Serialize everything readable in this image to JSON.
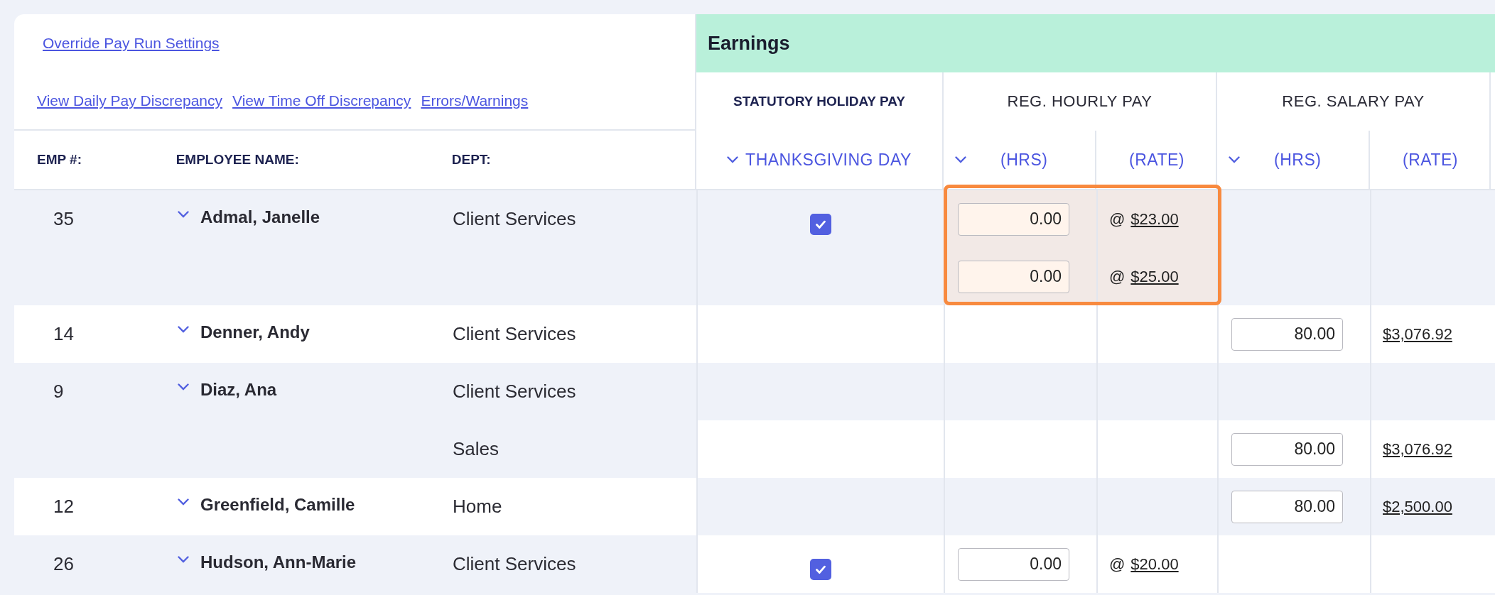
{
  "top_links": [
    {
      "label": "Override Pay Run Settings"
    }
  ],
  "discrepancy_links": [
    {
      "label": "View Daily Pay Discrepancy"
    },
    {
      "label": "View Time Off Discrepancy"
    },
    {
      "label": "Errors/Warnings"
    }
  ],
  "columns": {
    "emp_no": "EMP #:",
    "name": "EMPLOYEE NAME:",
    "dept": "DEPT:"
  },
  "section_title": "Earnings",
  "earning_groups": [
    {
      "title": "STATUTORY HOLIDAY PAY",
      "kind": "holiday",
      "subcolumns": [
        {
          "label": "THANKSGIVING DAY",
          "dropdown": true
        }
      ]
    },
    {
      "title": "REG. HOURLY PAY",
      "kind": "hours_rate",
      "subcolumns": [
        {
          "label": "(HRS)",
          "dropdown": true
        },
        {
          "label": "(RATE)",
          "dropdown": false
        }
      ]
    },
    {
      "title": "REG. SALARY PAY",
      "kind": "hours_rate",
      "subcolumns": [
        {
          "label": "(HRS)",
          "dropdown": true
        },
        {
          "label": "(RATE)",
          "dropdown": false
        }
      ]
    }
  ],
  "employees": [
    {
      "emp_no": "35",
      "name": "Admal, Janelle",
      "shaded": true,
      "hourly_highlighted": true,
      "lines": [
        {
          "dept": "Client Services",
          "shaded": true,
          "holiday_checked": true,
          "hourly": {
            "hours": "0.00",
            "prefix": "@",
            "rate": "$23.00"
          }
        },
        {
          "shaded": true,
          "hourly": {
            "hours": "0.00",
            "prefix": "@",
            "rate": "$25.00"
          }
        }
      ]
    },
    {
      "emp_no": "14",
      "name": "Denner, Andy",
      "shaded": false,
      "hourly_highlighted": false,
      "lines": [
        {
          "dept": "Client Services",
          "shaded": false,
          "salary": {
            "hours": "80.00",
            "rate": "$3,076.92"
          }
        }
      ]
    },
    {
      "emp_no": "9",
      "name": "Diaz, Ana",
      "shaded": true,
      "hourly_highlighted": false,
      "lines": [
        {
          "dept": "Client Services",
          "shaded": true
        },
        {
          "dept": "Sales",
          "shaded": false,
          "salary": {
            "hours": "80.00",
            "rate": "$3,076.92"
          }
        }
      ]
    },
    {
      "emp_no": "12",
      "name": "Greenfield, Camille",
      "shaded": false,
      "hourly_highlighted": false,
      "lines": [
        {
          "dept": "Home",
          "shaded": true,
          "salary": {
            "hours": "80.00",
            "rate": "$2,500.00"
          }
        }
      ]
    },
    {
      "emp_no": "26",
      "name": "Hudson, Ann-Marie",
      "shaded": true,
      "hourly_highlighted": false,
      "lines": [
        {
          "dept": "Client Services",
          "shaded": false,
          "holiday_checked": true,
          "hourly": {
            "hours": "0.00",
            "prefix": "@",
            "rate": "$20.00"
          }
        }
      ]
    }
  ]
}
